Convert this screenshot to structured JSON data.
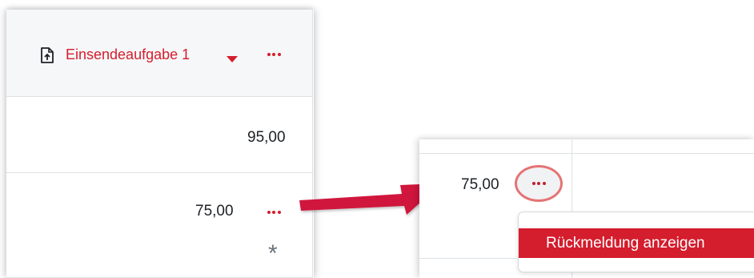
{
  "gradebook": {
    "column_header": {
      "title": "Einsendeaufgabe 1",
      "icon": "document-upload-icon",
      "sort_icon": "caret-down-icon",
      "menu_icon": "ellipsis-icon"
    },
    "rows": [
      {
        "grade": "95,00"
      },
      {
        "grade": "75,00",
        "menu_icon": "ellipsis-icon",
        "overridden_mark": "*"
      }
    ]
  },
  "zoom_inset": {
    "grade": "75,00",
    "menu_icon": "ellipsis-icon",
    "dropdown_item": "Rückmeldung anzeigen"
  },
  "colors": {
    "accent": "#d41d2d",
    "arrow": "#d0183c",
    "highlight_ring": "#e57373",
    "text": "#1d2125"
  }
}
